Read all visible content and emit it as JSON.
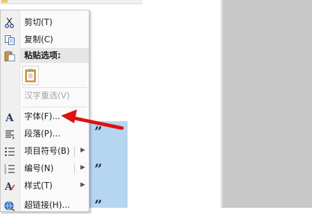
{
  "menu": {
    "cut": "剪切(T)",
    "copy": "复制(C)",
    "paste_options_header": "粘贴选项:",
    "reconvert": "汉字重选(V)",
    "font": "字体(F)...",
    "paragraph": "段落(P)...",
    "bullets": "项目符号(B)",
    "numbering": "编号(N)",
    "styles": "样式(T)",
    "hyperlink": "超链接(H)..."
  },
  "document": {
    "quote_mark": "”"
  },
  "colors": {
    "arrow": "#e01010",
    "selection": "#b6d5f1"
  }
}
